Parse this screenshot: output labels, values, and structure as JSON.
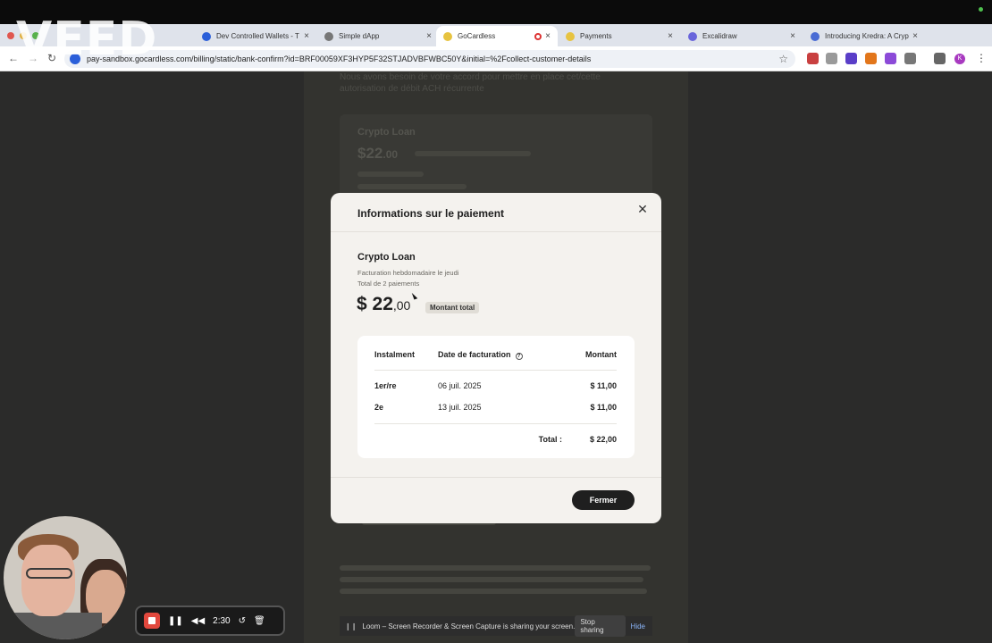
{
  "browser": {
    "tabs": [
      {
        "title": "Dev Controlled Wallets - T",
        "favicon_color": "#2b5fd9",
        "active": false
      },
      {
        "title": "Simple dApp",
        "favicon_color": "#777777",
        "active": false
      },
      {
        "title": "GoCardless",
        "favicon_color": "#e7c340",
        "active": true
      },
      {
        "title": "Payments",
        "favicon_color": "#e7c340",
        "active": false
      },
      {
        "title": "Excalidraw",
        "favicon_color": "#6965db",
        "active": false
      },
      {
        "title": "Introducing Kredra: A Cryp",
        "favicon_color": "#4a6cd4",
        "active": false
      }
    ],
    "url": "pay-sandbox.gocardless.com/billing/static/bank-confirm?id=BRF00059XF3HYP5F32STJADVBFWBC50Y&initial=%2Fcollect-customer-details",
    "profile_initial": "K"
  },
  "background": {
    "intro": "Nous avons besoin de votre accord pour mettre en place cet/cette autorisation de débit ACH récurrente",
    "card_title": "Crypto Loan",
    "card_amount": "$22",
    "card_amount_cents": ".00"
  },
  "modal": {
    "title": "Informations sur le paiement",
    "product": "Crypto Loan",
    "billing_frequency": "Facturation hebdomadaire le jeudi",
    "payment_count": "Total de 2 paiements",
    "amount_main": "$ 22",
    "amount_cents": ",00",
    "amount_badge": "Montant total",
    "table": {
      "headers": {
        "instalment": "Instalment",
        "date": "Date de facturation",
        "amount": "Montant"
      },
      "rows": [
        {
          "instalment": "1er/re",
          "date": "06 juil. 2025",
          "amount": "$ 11,00"
        },
        {
          "instalment": "2e",
          "date": "13 juil. 2025",
          "amount": "$ 11,00"
        }
      ],
      "total_label": "Total :",
      "total_value": "$ 22,00"
    },
    "close_button": "Fermer"
  },
  "overlays": {
    "watermark": "VEED",
    "loom_timer": "2:30",
    "share_message": "Loom – Screen Recorder & Screen Capture is sharing your screen.",
    "stop_sharing": "Stop sharing",
    "hide": "Hide"
  }
}
